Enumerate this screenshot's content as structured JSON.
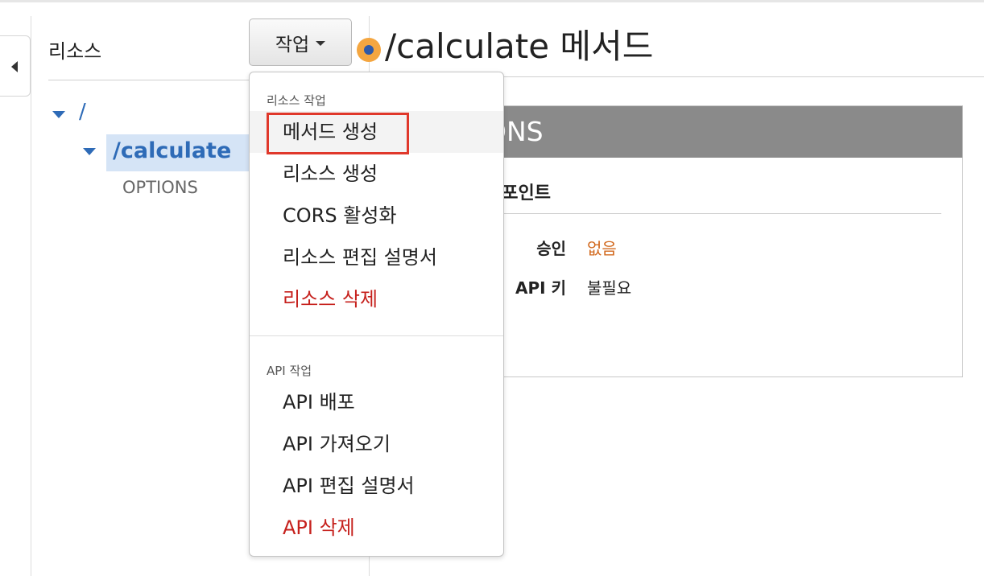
{
  "sidebar": {
    "title": "리소스",
    "tree": {
      "root": "/",
      "child": "/calculate",
      "method": "OPTIONS"
    }
  },
  "actions_button": {
    "label": "작업"
  },
  "page": {
    "title": "/calculate 메서드"
  },
  "panel": {
    "header": "ONS",
    "section_title": "드포인트",
    "rows": [
      {
        "label": "승인",
        "value": "없음",
        "value_color": "#d2691e"
      },
      {
        "label": "API 키",
        "value": "불필요",
        "value_color": "#222222"
      }
    ]
  },
  "menu": {
    "resource_group": "리소스 작업",
    "resource_items": [
      "메서드 생성",
      "리소스 생성",
      "CORS 활성화",
      "리소스 편집 설명서",
      "리소스 삭제"
    ],
    "api_group": "API 작업",
    "api_items": [
      "API 배포",
      "API 가져오기",
      "API 편집 설명서",
      "API 삭제"
    ],
    "highlighted_item": "메서드 생성"
  },
  "colors": {
    "link_blue": "#2e6bb7",
    "danger_red": "#c6211d",
    "highlight_red": "#e0382b",
    "badge_orange": "#f4a640"
  }
}
